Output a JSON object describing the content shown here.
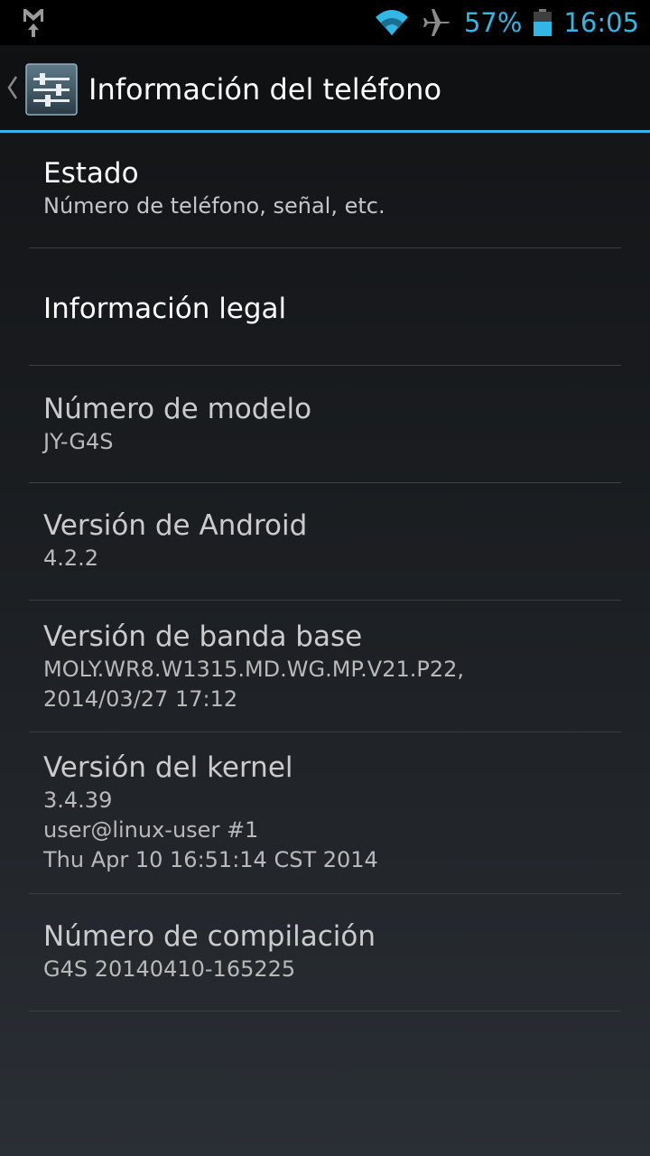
{
  "statusbar": {
    "battery_percent": "57%",
    "time": "16:05",
    "icons": [
      "gmail-upload-icon",
      "wifi-icon",
      "airplane-mode-icon",
      "battery-icon"
    ]
  },
  "actionbar": {
    "title": "Información del teléfono",
    "icon": "settings-sliders-icon"
  },
  "items": [
    {
      "title": "Estado",
      "summary": "Número de teléfono, señal, etc."
    },
    {
      "title": "Información legal"
    },
    {
      "title": "Número de modelo",
      "summary": "JY-G4S"
    },
    {
      "title": "Versión de Android",
      "summary": "4.2.2"
    },
    {
      "title": "Versión de banda base",
      "summary_lines": [
        "MOLY.WR8.W1315.MD.WG.MP.V21.P22,",
        "2014/03/27 17:12"
      ]
    },
    {
      "title": "Versión del kernel",
      "summary_lines": [
        "3.4.39",
        "user@linux-user #1",
        "Thu Apr 10 16:51:14 CST 2014"
      ]
    },
    {
      "title": "Número de compilación",
      "summary": "G4S 20140410-165225"
    }
  ],
  "colors": {
    "accent": "#33b5e5",
    "background": "#1b1d21",
    "divider": "#3a3d41"
  }
}
